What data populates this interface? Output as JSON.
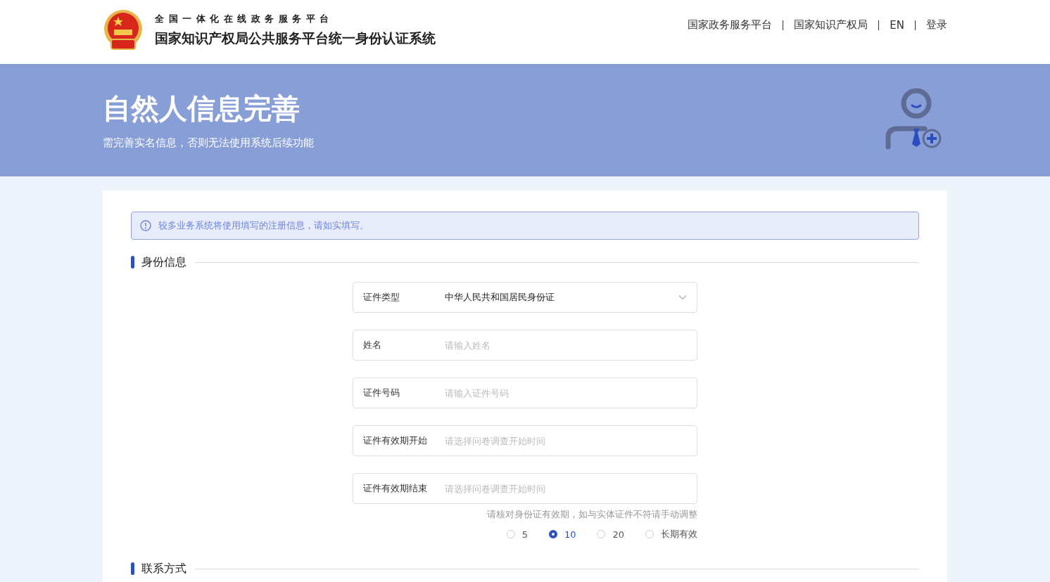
{
  "header": {
    "subtitle": "全国一体化在线政务服务平台",
    "title": "国家知识产权局公共服务平台统一身份认证系统",
    "nav": [
      {
        "label": "国家政务服务平台"
      },
      {
        "label": "国家知识产权局"
      },
      {
        "label": "EN"
      },
      {
        "label": "登录"
      }
    ]
  },
  "banner": {
    "title": "自然人信息完善",
    "subtitle": "需完善实名信息，否则无法使用系统后续功能"
  },
  "alert": {
    "text": "较多业务系统将使用填写的注册信息，请如实填写。"
  },
  "sections": [
    {
      "title": "身份信息"
    },
    {
      "title": "联系方式"
    }
  ],
  "fields": [
    {
      "kind": "select",
      "label": "证件类型",
      "value": "中华人民共和国居民身份证"
    },
    {
      "kind": "input",
      "label": "姓名",
      "placeholder": "请输入姓名"
    },
    {
      "kind": "input",
      "label": "证件号码",
      "placeholder": "请输入证件号码"
    },
    {
      "kind": "input",
      "label": "证件有效期开始",
      "placeholder": "请选择问卷调查开始时间"
    },
    {
      "kind": "input",
      "label": "证件有效期结束",
      "placeholder": "请选择问卷调查开始时间"
    }
  ],
  "validity_hint": "请核对身份证有效期，如与实体证件不符请手动调整",
  "validity_options": [
    {
      "label": "5",
      "selected": false
    },
    {
      "label": "10",
      "selected": true
    },
    {
      "label": "20",
      "selected": false
    },
    {
      "label": "长期有效",
      "selected": false
    }
  ]
}
